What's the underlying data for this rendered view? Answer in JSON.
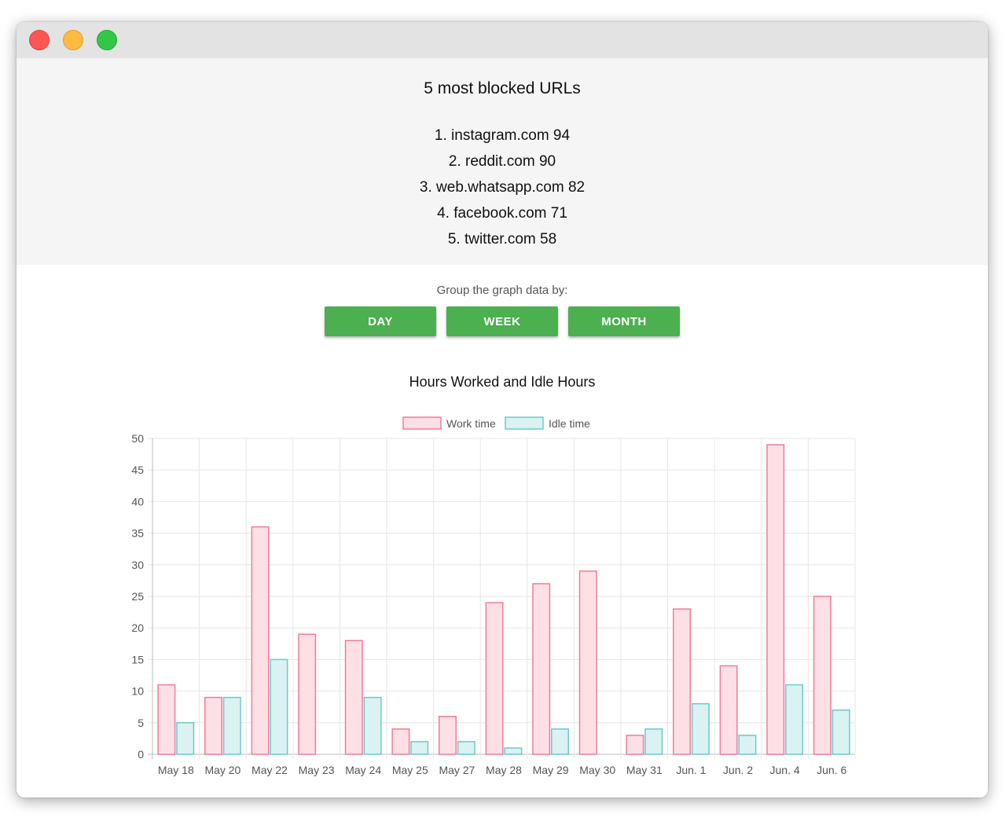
{
  "top_urls": {
    "title": "5 most blocked URLs",
    "items": [
      "1. instagram.com 94",
      "2. reddit.com 90",
      "3. web.whatsapp.com 82",
      "4. facebook.com 71",
      "5. twitter.com 58"
    ]
  },
  "grouping": {
    "label": "Group the graph data by:",
    "buttons": [
      "DAY",
      "WEEK",
      "MONTH"
    ],
    "button_color": "#4caf50"
  },
  "chart_data": {
    "type": "bar",
    "title": "Hours Worked and Idle Hours",
    "xlabel": "",
    "ylabel": "",
    "ylim": [
      0,
      50
    ],
    "y_ticks": [
      0,
      5,
      10,
      15,
      20,
      25,
      30,
      35,
      40,
      45,
      50
    ],
    "grid": true,
    "legend_position": "top",
    "categories": [
      "May 18",
      "May 20",
      "May 22",
      "May 23",
      "May 24",
      "May 25",
      "May 27",
      "May 28",
      "May 29",
      "May 30",
      "May 31",
      "Jun. 1",
      "Jun. 2",
      "Jun. 4",
      "Jun. 6"
    ],
    "series": [
      {
        "name": "Work time",
        "values": [
          11,
          9,
          36,
          19,
          18,
          4,
          6,
          24,
          27,
          29,
          3,
          23,
          14,
          49,
          25
        ],
        "fill": "#fde0e6",
        "stroke": "#f07c98"
      },
      {
        "name": "Idle time",
        "values": [
          5,
          9,
          15,
          0,
          9,
          2,
          2,
          1,
          4,
          0,
          4,
          8,
          3,
          11,
          7
        ],
        "fill": "#daf2f2",
        "stroke": "#6bcaca"
      }
    ]
  }
}
